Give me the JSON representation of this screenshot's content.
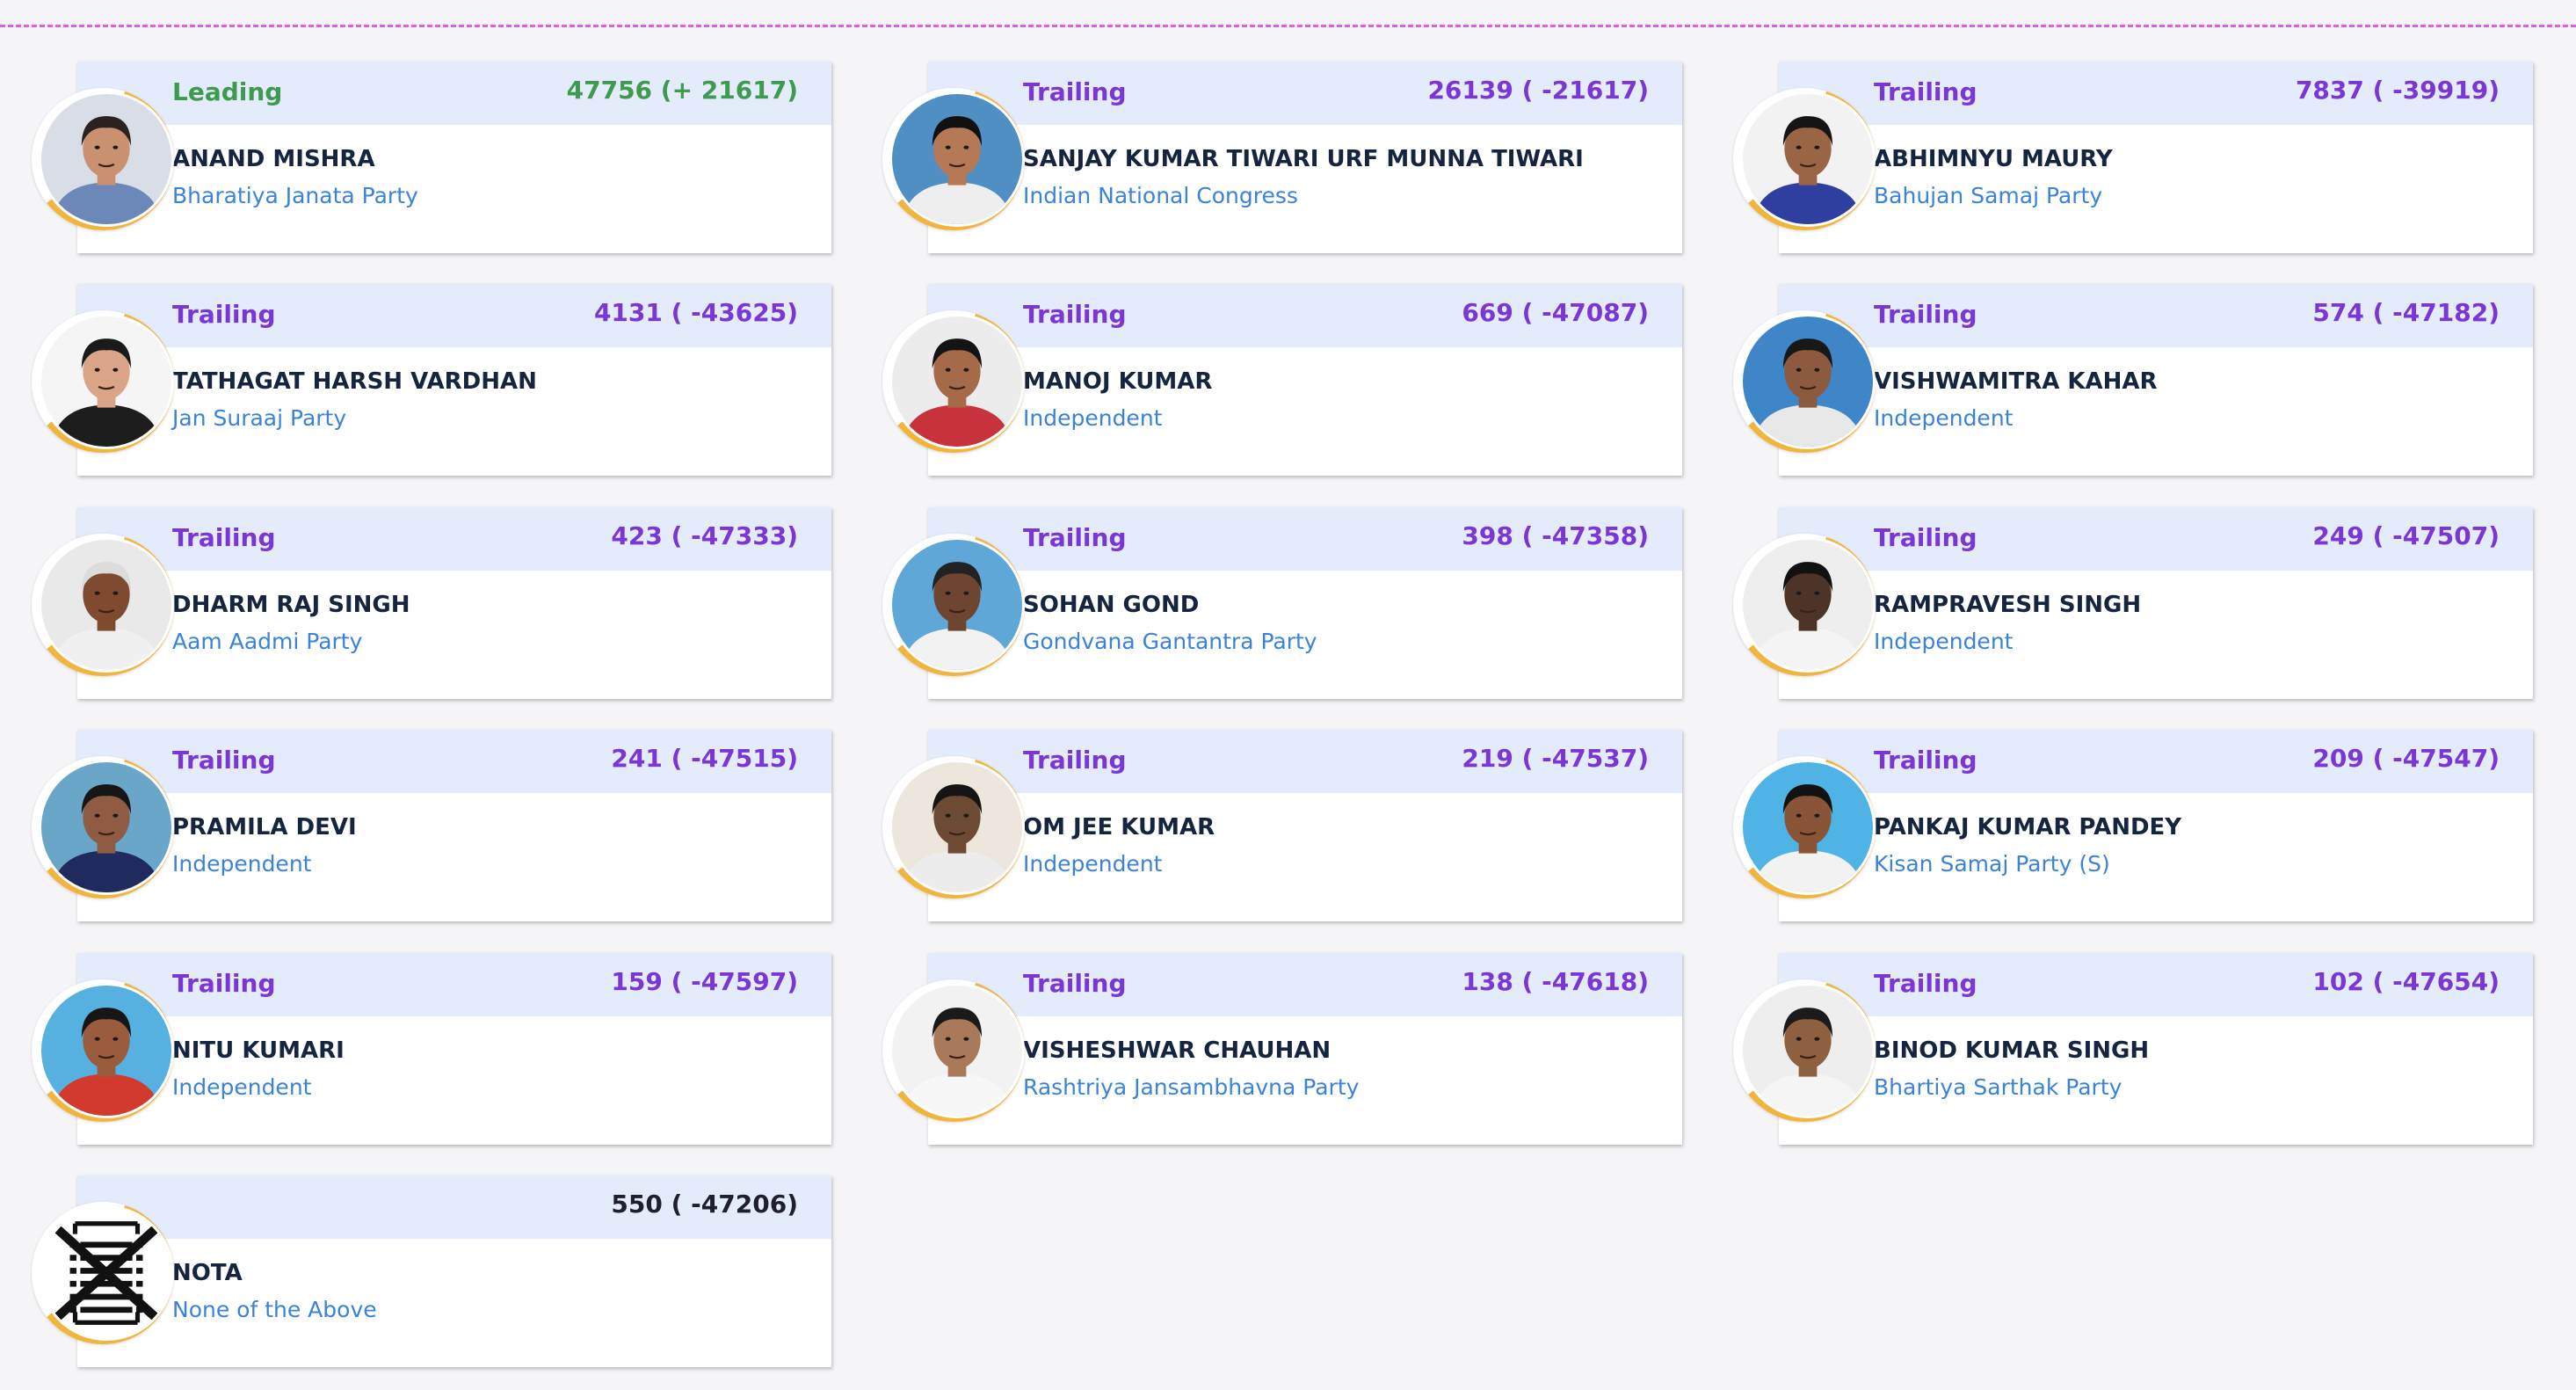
{
  "candidates": [
    {
      "status": "Leading",
      "votes": "47756 (+ 21617)",
      "name": "ANAND MISHRA",
      "party": "Bharatiya Janata Party",
      "leading": true,
      "bg": "#d9dde6",
      "skin": "#c99170",
      "hair": "#2a2220",
      "shirt": "#6b88b8"
    },
    {
      "status": "Trailing",
      "votes": "26139 ( -21617)",
      "name": "SANJAY KUMAR TIWARI URF MUNNA TIWARI",
      "party": "Indian National Congress",
      "bg": "#4f8fc4",
      "skin": "#b57a55",
      "hair": "#111111",
      "shirt": "#eeeeee"
    },
    {
      "status": "Trailing",
      "votes": "7837 ( -39919)",
      "name": "ABHIMNYU MAURY",
      "party": "Bahujan Samaj Party",
      "bg": "#f2f2f2",
      "skin": "#9a6545",
      "hair": "#151515",
      "shirt": "#2f3fa0"
    },
    {
      "status": "Trailing",
      "votes": "4131 ( -43625)",
      "name": "TATHAGAT HARSH VARDHAN",
      "party": "Jan Suraaj Party",
      "bg": "#f5f5f5",
      "skin": "#d9a586",
      "hair": "#1a1a1a",
      "shirt": "#1d1d1d"
    },
    {
      "status": "Trailing",
      "votes": "669 ( -47087)",
      "name": "MANOJ KUMAR",
      "party": "Independent",
      "bg": "#ececec",
      "skin": "#a56a48",
      "hair": "#141414",
      "shirt": "#c8323c"
    },
    {
      "status": "Trailing",
      "votes": "574 ( -47182)",
      "name": "VISHWAMITRA KAHAR",
      "party": "Independent",
      "bg": "#3f86c8",
      "skin": "#8c5a3e",
      "hair": "#181818",
      "shirt": "#e8e8e8"
    },
    {
      "status": "Trailing",
      "votes": "423 ( -47333)",
      "name": "DHARM RAJ SINGH",
      "party": "Aam Aadmi Party",
      "bg": "#e9e9e9",
      "skin": "#7e4a30",
      "hair": "#dcdcdc",
      "shirt": "#f0f0f0"
    },
    {
      "status": "Trailing",
      "votes": "398 ( -47358)",
      "name": "SOHAN GOND",
      "party": "Gondvana Gantantra Party",
      "bg": "#5fa7d6",
      "skin": "#6e4530",
      "hair": "#222222",
      "shirt": "#f2f2f2"
    },
    {
      "status": "Trailing",
      "votes": "249 ( -47507)",
      "name": "RAMPRAVESH SINGH",
      "party": "Independent",
      "bg": "#eeeeee",
      "skin": "#4e3426",
      "hair": "#111111",
      "shirt": "#f4f4f4"
    },
    {
      "status": "Trailing",
      "votes": "241 ( -47515)",
      "name": "PRAMILA DEVI",
      "party": "Independent",
      "bg": "#6aa6c7",
      "skin": "#8f5b42",
      "hair": "#161616",
      "shirt": "#1e2b5c"
    },
    {
      "status": "Trailing",
      "votes": "219 ( -47537)",
      "name": "OM JEE KUMAR",
      "party": "Independent",
      "bg": "#ece6dd",
      "skin": "#6d4a33",
      "hair": "#141414",
      "shirt": "#ececec"
    },
    {
      "status": "Trailing",
      "votes": "209 ( -47547)",
      "name": "PANKAJ KUMAR PANDEY",
      "party": "Kisan Samaj Party (S)",
      "bg": "#4fb3e6",
      "skin": "#8a5536",
      "hair": "#121212",
      "shirt": "#f2f2f2"
    },
    {
      "status": "Trailing",
      "votes": "159 ( -47597)",
      "name": "NITU KUMARI",
      "party": "Independent",
      "bg": "#56b0e0",
      "skin": "#9a5c3c",
      "hair": "#161616",
      "shirt": "#d23a2e"
    },
    {
      "status": "Trailing",
      "votes": "138 ( -47618)",
      "name": "VISHESHWAR CHAUHAN",
      "party": "Rashtriya Jansambhavna Party",
      "bg": "#f2f2f2",
      "skin": "#a97a5a",
      "hair": "#1a1a1a",
      "shirt": "#f7f7f7"
    },
    {
      "status": "Trailing",
      "votes": "102 ( -47654)",
      "name": "BINOD KUMAR SINGH",
      "party": "Bhartiya Sarthak Party",
      "bg": "#eeeeee",
      "skin": "#8d6040",
      "hair": "#1b1b1b",
      "shirt": "#f5f5f5"
    },
    {
      "status": "",
      "votes": "550 ( -47206)",
      "name": "NOTA",
      "party": "None of the Above",
      "nota": true
    }
  ]
}
